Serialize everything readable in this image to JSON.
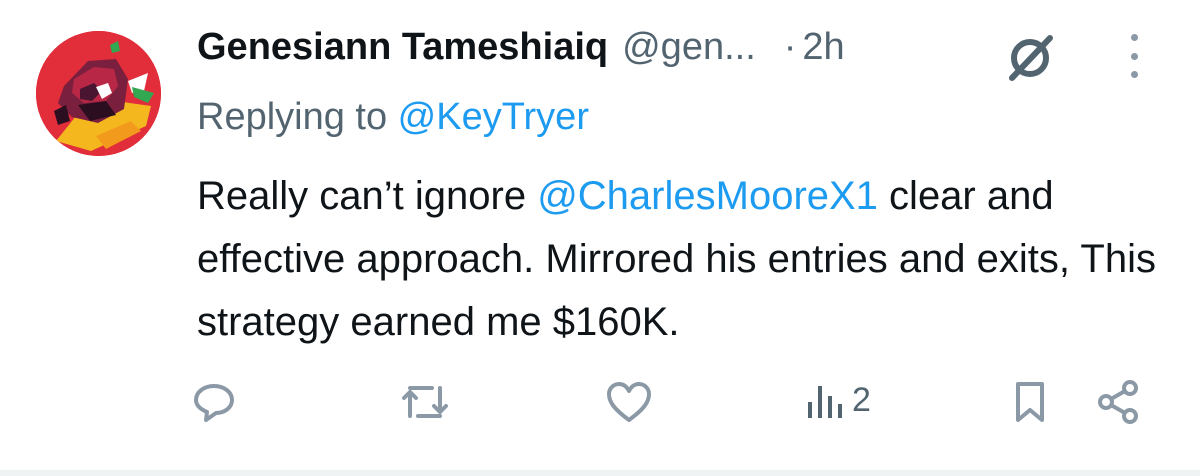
{
  "tweet": {
    "author_name": "Genesiann Tameshiaiq",
    "author_handle": "@gen...",
    "separator": "·",
    "time": "2h",
    "replying_prefix": "Replying to ",
    "replying_to": "@KeyTryer",
    "body_part1": "Really can’t ignore ",
    "body_mention": "@CharlesMooreX1",
    "body_part2": " clear and effective approach. Mirrored his entries and exits, This strategy earned me $160K."
  },
  "actions": {
    "views_count": "2",
    "icons": [
      "reply-icon",
      "retweet-icon",
      "like-icon",
      "views-icon",
      "bookmark-icon",
      "share-icon"
    ]
  },
  "colors": {
    "text": "#0f1419",
    "secondary": "#536471",
    "link": "#1d9bf0",
    "icon": "#8b98a5",
    "avatar_bg": "#e22d3a"
  }
}
